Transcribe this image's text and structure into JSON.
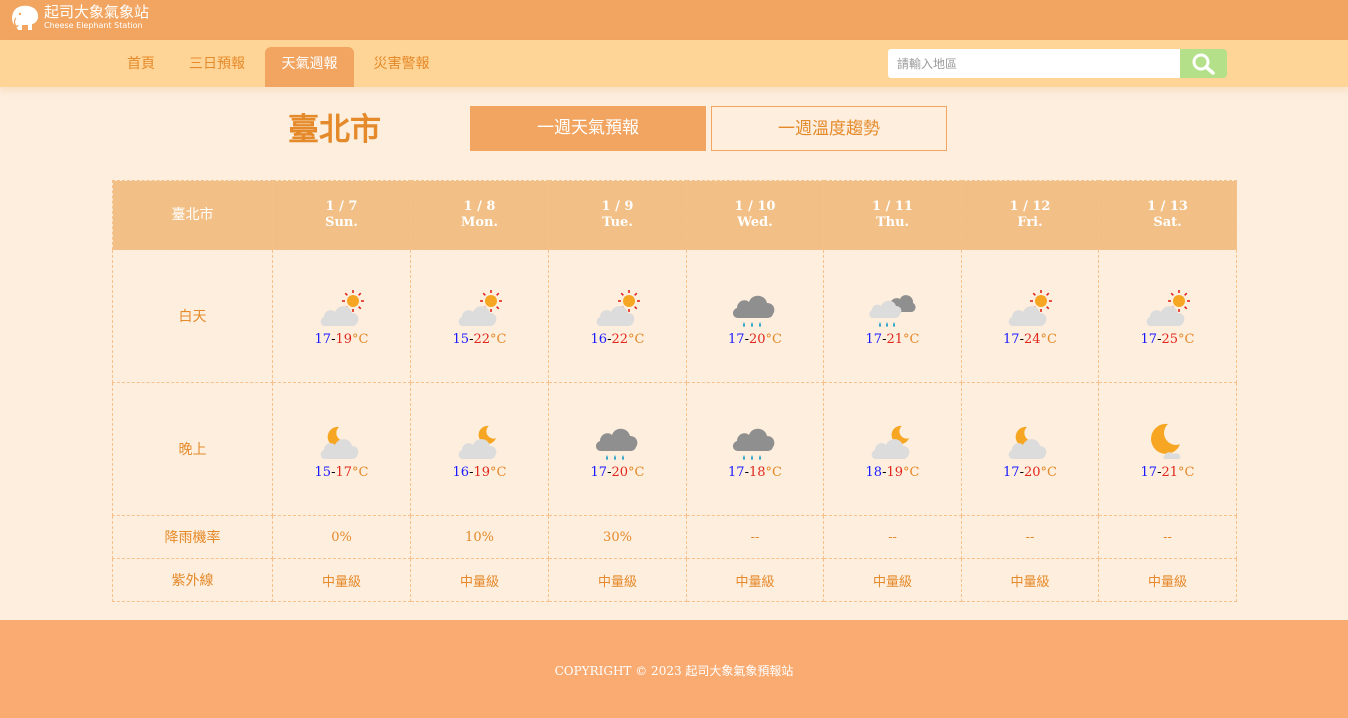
{
  "brand": {
    "title": "起司大象氣象站",
    "subtitle": "Cheese Elephant Station"
  },
  "nav": {
    "items": [
      {
        "label": "首頁",
        "active": false
      },
      {
        "label": "三日預報",
        "active": false
      },
      {
        "label": "天氣週報",
        "active": true
      },
      {
        "label": "災害警報",
        "active": false
      }
    ]
  },
  "search": {
    "placeholder": "請輸入地區",
    "icon": "search-icon"
  },
  "page": {
    "city": "臺北市",
    "tabs": [
      {
        "label": "一週天氣預報",
        "active": true
      },
      {
        "label": "一週溫度趨勢",
        "active": false
      }
    ]
  },
  "table": {
    "corner": "臺北市",
    "row_labels": {
      "day": "白天",
      "night": "晚上",
      "rain": "降雨機率",
      "uv": "紫外線"
    },
    "unit": "°C",
    "days": [
      {
        "date": "1 / 7",
        "weekday": "Sun.",
        "day": {
          "icon": "partly-cloudy-day-icon",
          "min": "17",
          "max": "19"
        },
        "night": {
          "icon": "moon-cloud-icon",
          "min": "15",
          "max": "17"
        },
        "rain": "0%",
        "uv": "中量級"
      },
      {
        "date": "1 / 8",
        "weekday": "Mon.",
        "day": {
          "icon": "partly-cloudy-day-icon",
          "min": "15",
          "max": "22"
        },
        "night": {
          "icon": "cloudy-night-icon",
          "min": "16",
          "max": "19"
        },
        "rain": "10%",
        "uv": "中量級"
      },
      {
        "date": "1 / 9",
        "weekday": "Tue.",
        "day": {
          "icon": "partly-cloudy-day-icon",
          "min": "16",
          "max": "22"
        },
        "night": {
          "icon": "rain-cloud-icon",
          "min": "17",
          "max": "20"
        },
        "rain": "30%",
        "uv": "中量級"
      },
      {
        "date": "1 / 10",
        "weekday": "Wed.",
        "day": {
          "icon": "rain-cloud-icon",
          "min": "17",
          "max": "20"
        },
        "night": {
          "icon": "rain-cloud-icon",
          "min": "17",
          "max": "18"
        },
        "rain": "--",
        "uv": "中量級"
      },
      {
        "date": "1 / 11",
        "weekday": "Thu.",
        "day": {
          "icon": "cloudy-rain-icon",
          "min": "17",
          "max": "21"
        },
        "night": {
          "icon": "cloudy-night-icon",
          "min": "18",
          "max": "19"
        },
        "rain": "--",
        "uv": "中量級"
      },
      {
        "date": "1 / 12",
        "weekday": "Fri.",
        "day": {
          "icon": "partly-cloudy-day-icon",
          "min": "17",
          "max": "24"
        },
        "night": {
          "icon": "moon-cloud-icon",
          "min": "17",
          "max": "20"
        },
        "rain": "--",
        "uv": "中量級"
      },
      {
        "date": "1 / 13",
        "weekday": "Sat.",
        "day": {
          "icon": "partly-cloudy-day-icon",
          "min": "17",
          "max": "25"
        },
        "night": {
          "icon": "clear-night-icon",
          "min": "17",
          "max": "21"
        },
        "rain": "--",
        "uv": "中量級"
      }
    ]
  },
  "footer": {
    "copyright": "COPYRIGHT © 2023 起司大象氣象預報站"
  },
  "colors": {
    "topbar": "#f2a560",
    "navbar": "#ffd597",
    "accent": "#e58a2a",
    "background": "#fdeede",
    "footer": "#f9ab72",
    "search_button": "#b3e089",
    "min_temp": "#1a1aff",
    "max_temp": "#e0261b"
  }
}
